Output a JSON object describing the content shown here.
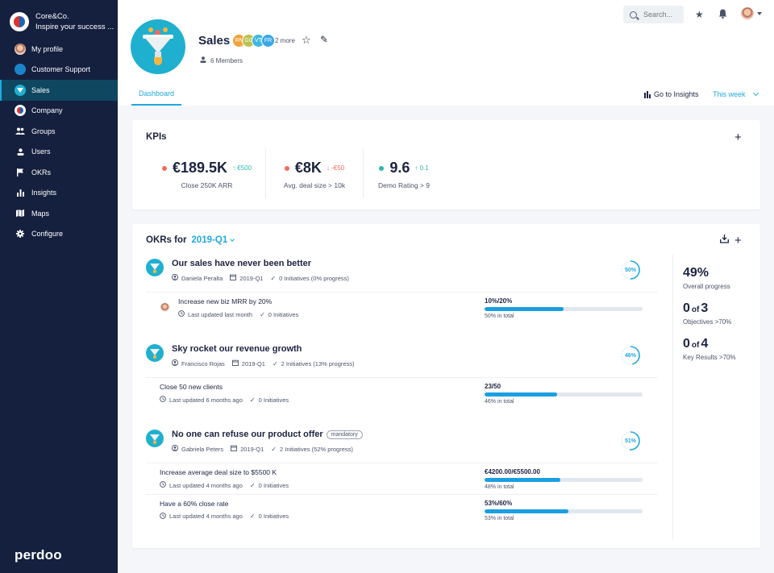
{
  "org": {
    "name": "Core&Co.",
    "tagline": "Inspire your success ..."
  },
  "sidebar": {
    "items": [
      {
        "label": "My profile",
        "icon": "avatar-icon"
      },
      {
        "label": "Customer Support",
        "icon": "customer-support-icon"
      },
      {
        "label": "Sales",
        "icon": "funnel-icon",
        "active": true
      },
      {
        "label": "Company",
        "icon": "company-logo-icon"
      },
      {
        "label": "Groups",
        "icon": "groups-icon"
      },
      {
        "label": "Users",
        "icon": "user-icon"
      },
      {
        "label": "OKRs",
        "icon": "flag-icon"
      },
      {
        "label": "Insights",
        "icon": "bar-chart-icon"
      },
      {
        "label": "Maps",
        "icon": "map-icon"
      },
      {
        "label": "Configure",
        "icon": "gear-icon"
      }
    ],
    "logo": "perdoo"
  },
  "topbar": {
    "search_placeholder": "Search...",
    "icons": [
      "star-icon",
      "bell-icon",
      "user-avatar-icon",
      "caret-down-icon"
    ]
  },
  "header": {
    "team_name": "Sales",
    "badges": [
      {
        "initials": "RN",
        "color": "#f0a33a"
      },
      {
        "initials": "GC",
        "color": "#b9c24a"
      },
      {
        "initials": "VT",
        "color": "#3fb8e0"
      },
      {
        "initials": "FR",
        "color": "#3aa7e8"
      }
    ],
    "more_label": "2 more",
    "members_label": "6 Members",
    "tab_dashboard": "Dashboard",
    "goto_insights": "Go to Insights",
    "period": "This week"
  },
  "kpis": {
    "title": "KPIs",
    "items": [
      {
        "value": "€189.5K",
        "delta": "↑ €500",
        "direction": "up",
        "label": "Close 250K ARR",
        "dot_color": "#f26b5b"
      },
      {
        "value": "€8K",
        "delta": "↓ -€50",
        "direction": "down",
        "label": "Avg. deal size > 10k",
        "dot_color": "#f26b5b"
      },
      {
        "value": "9.6",
        "delta": "↑ 0.1",
        "direction": "up",
        "label": "Demo Rating > 9",
        "dot_color": "#2bbbad"
      }
    ],
    "colors": {
      "up": "#2bbbad",
      "down": "#f26b5b"
    }
  },
  "okrs": {
    "title": "OKRs for",
    "period": "2019-Q1",
    "objectives": [
      {
        "name": "Our sales have never been better",
        "tag": null,
        "owner": "Daniela Peralta",
        "period": "2019-Q1",
        "initiatives": "0 Initiatives (0% progress)",
        "progress_label": "50%",
        "progress": 0.5,
        "key_results": [
          {
            "name": "Increase new biz MRR by 20%",
            "updated": "Last updated last month",
            "initiatives": "0 Initiatives",
            "value": "10%/20%",
            "progress": 0.5,
            "total": "50% in total",
            "has_avatar": true
          }
        ]
      },
      {
        "name": "Sky rocket our revenue growth",
        "tag": null,
        "owner": "Francisco Rojas",
        "period": "2019-Q1",
        "initiatives": "2 Initiatives (13% progress)",
        "progress_label": "46%",
        "progress": 0.46,
        "key_results": [
          {
            "name": "Close 50 new clients",
            "updated": "Last updated 6 months ago",
            "initiatives": "0 Initiatives",
            "value": "23/50",
            "progress": 0.46,
            "total": "46% in total",
            "has_avatar": false
          }
        ]
      },
      {
        "name": "No one can refuse our product offer",
        "tag": "mandatory",
        "owner": "Gabriela Peters",
        "period": "2019-Q1",
        "initiatives": "2 Initiatives (52% progress)",
        "progress_label": "51%",
        "progress": 0.51,
        "key_results": [
          {
            "name": "Increase average deal size to $5500 K",
            "updated": "Last updated 4 months ago",
            "initiatives": "0 Initiatives",
            "value": "€4200.00/€5500.00",
            "progress": 0.48,
            "total": "48% in total",
            "has_avatar": false
          },
          {
            "name": "Have a 60% close rate",
            "updated": "Last updated 4 months ago",
            "initiatives": "0 Initiatives",
            "value": "53%/60%",
            "progress": 0.53,
            "total": "53% in total",
            "has_avatar": false
          }
        ]
      }
    ],
    "stats": [
      {
        "value": "49%",
        "label": "Overall progress"
      },
      {
        "value_a": "0",
        "of": "of",
        "value_b": "3",
        "label": "Objectives >70%"
      },
      {
        "value_a": "0",
        "of": "of",
        "value_b": "4",
        "label": "Key Results >70%"
      }
    ]
  },
  "colors": {
    "accent": "#21a8df",
    "sidebar_bg": "#15203f",
    "sidebar_active": "#0f4761",
    "bar_fill": "#1a9fe0"
  }
}
